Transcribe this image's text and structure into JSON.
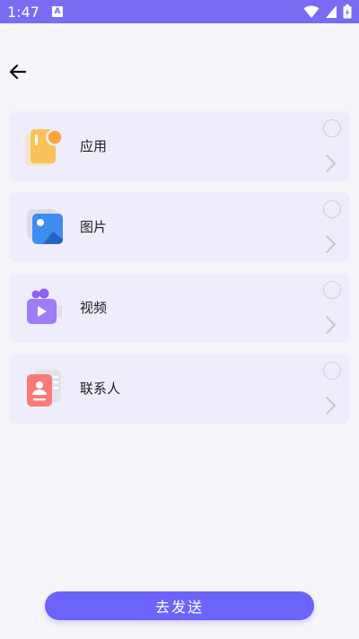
{
  "status_bar": {
    "time": "1:47",
    "notification_letter": "A"
  },
  "colors": {
    "status_bar": "#7A6BF5",
    "card_background": "#EFEDFC",
    "page_background": "#F6F5F9",
    "primary_button": "#6C63FA"
  },
  "categories": [
    {
      "label": "应用",
      "icon": "app-icon",
      "selected": false
    },
    {
      "label": "图片",
      "icon": "image-icon",
      "selected": false
    },
    {
      "label": "视频",
      "icon": "video-icon",
      "selected": false
    },
    {
      "label": "联系人",
      "icon": "contact-icon",
      "selected": false
    }
  ],
  "footer": {
    "send_label": "去发送"
  }
}
